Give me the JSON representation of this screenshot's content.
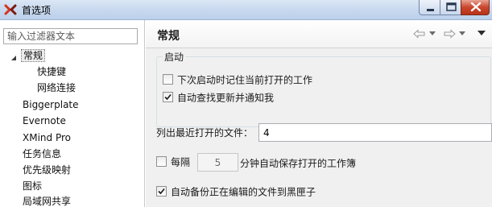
{
  "window": {
    "title": "首选项",
    "icon": "xmind-logo-icon",
    "controls": [
      "minimize-icon",
      "maximize-icon",
      "close-icon"
    ]
  },
  "sidebar": {
    "filter_placeholder": "输入过滤器文本",
    "tree": [
      {
        "label": "常规",
        "expanded": true,
        "selected": true,
        "level": 0
      },
      {
        "label": "快捷键",
        "level": 1
      },
      {
        "label": "网络连接",
        "level": 1
      },
      {
        "label": "Biggerplate",
        "level": 0
      },
      {
        "label": "Evernote",
        "level": 0
      },
      {
        "label": "XMind Pro",
        "level": 0
      },
      {
        "label": "任务信息",
        "level": 0
      },
      {
        "label": "优先级映射",
        "level": 0
      },
      {
        "label": "图标",
        "level": 0
      },
      {
        "label": "局域网共享",
        "level": 0
      }
    ]
  },
  "page": {
    "title": "常规",
    "nav_icons": [
      "back-arrow-icon",
      "back-dropdown-icon",
      "forward-arrow-icon",
      "forward-dropdown-icon",
      "view-menu-icon"
    ],
    "startup_group": {
      "title": "启动",
      "options": [
        {
          "label": "下次启动时记住当前打开的工作",
          "checked": false
        },
        {
          "label": "自动查找更新并通知我",
          "checked": true
        }
      ]
    },
    "recent_files": {
      "label": "列出最近打开的文件：",
      "value": "4"
    },
    "autosave": {
      "label": "每隔",
      "checked": false,
      "minutes": "5",
      "suffix": "分钟自动保存打开的工作簿"
    },
    "backup": {
      "label": "自动备份正在编辑的文件到黑匣子",
      "checked": true
    }
  },
  "colors": {
    "titlebar": "#c7d8ee",
    "close_button": "#c9452c",
    "right_pane_bg": "#f0f0f0",
    "check_mark": "#1a1a1a"
  }
}
